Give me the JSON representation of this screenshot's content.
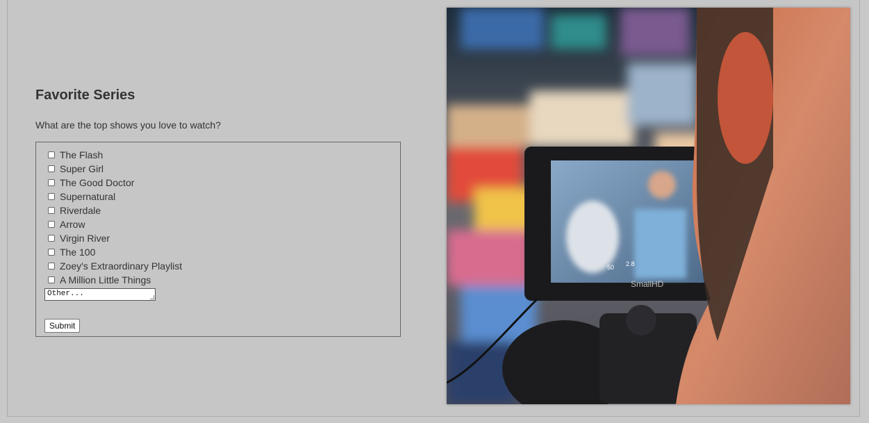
{
  "form": {
    "title": "Favorite Series",
    "question": "What are the top shows you love to watch?",
    "options": [
      "The Flash",
      "Super Girl",
      "The Good Doctor",
      "Supernatural",
      "Riverdale",
      "Arrow",
      "Virgin River",
      "The 100",
      "Zoey's Extraordinary Playlist",
      "A Million Little Things"
    ],
    "other_value": "Other...",
    "submit_label": "Submit"
  },
  "photo": {
    "monitor_brand": "SmallHD",
    "overlay_left": "50",
    "overlay_right": "2.8"
  }
}
